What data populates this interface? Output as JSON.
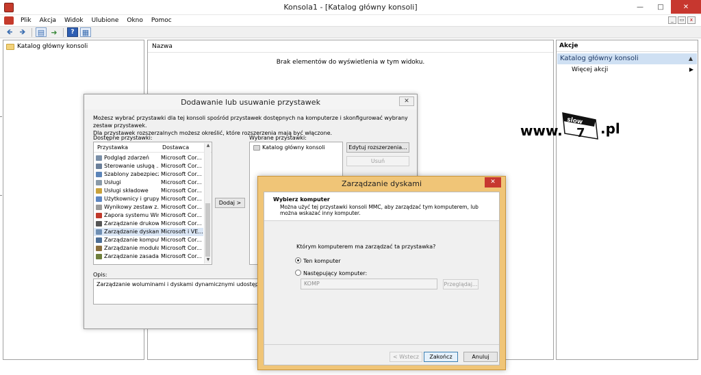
{
  "window": {
    "title": "Konsola1 - [Katalog główny konsoli]"
  },
  "menu": {
    "items": [
      "Plik",
      "Akcja",
      "Widok",
      "Ulubione",
      "Okno",
      "Pomoc"
    ]
  },
  "toolbar": {
    "buttons": [
      "back-arrow-icon",
      "forward-arrow-icon",
      "show-hide-tree-icon",
      "export-list-icon",
      "help-icon",
      "show-hide-action-pane-icon"
    ]
  },
  "tree": {
    "root": "Katalog główny konsoli"
  },
  "center": {
    "column": "Nazwa",
    "empty": "Brak elementów do wyświetlenia w tym widoku."
  },
  "actions": {
    "header": "Akcje",
    "selected": "Katalog główny konsoli",
    "more": "Więcej akcji"
  },
  "logo": {
    "prefix": "www.",
    "box_top": "slow",
    "box_num": "7",
    "suffix": ".pl"
  },
  "snapin_dialog": {
    "title": "Dodawanie lub usuwanie przystawek",
    "intro_line1": "Możesz wybrać przystawki dla tej konsoli spośród przystawek dostępnych na komputerze i skonfigurować wybrany zestaw przystawek.",
    "intro_line2": "Dla przystawek rozszerzalnych możesz określić, które rozszerzenia mają być włączone.",
    "available_label": "Dostępne przystawki:",
    "col_snapin": "Przystawka",
    "col_vendor": "Dostawca",
    "available": [
      {
        "name": "Podgląd zdarzeń",
        "vendor": "Microsoft Cor...",
        "color": "#7a8fa8"
      },
      {
        "name": "Sterowanie usługą ...",
        "vendor": "Microsoft Cor...",
        "color": "#6a7f9a"
      },
      {
        "name": "Szablony zabezpieczeń",
        "vendor": "Microsoft Cor...",
        "color": "#5b84b8"
      },
      {
        "name": "Usługi",
        "vendor": "Microsoft Cor...",
        "color": "#8a9aa8"
      },
      {
        "name": "Usługi składowe",
        "vendor": "Microsoft Cor...",
        "color": "#c9a23c"
      },
      {
        "name": "Użytkownicy i grupy...",
        "vendor": "Microsoft Cor...",
        "color": "#5d86c2"
      },
      {
        "name": "Wynikowy zestaw z...",
        "vendor": "Microsoft Cor...",
        "color": "#9a9a9a"
      },
      {
        "name": "Zapora systemu Win...",
        "vendor": "Microsoft Cor...",
        "color": "#c0392b"
      },
      {
        "name": "Zarządzanie drukow...",
        "vendor": "Microsoft Cor...",
        "color": "#555555"
      },
      {
        "name": "Zarządzanie dyskami",
        "vendor": "Microsoft i VE...",
        "color": "#6f8fb3"
      },
      {
        "name": "Zarządzanie komput...",
        "vendor": "Microsoft Cor...",
        "color": "#4c6e96"
      },
      {
        "name": "Zarządzanie moduła...",
        "vendor": "Microsoft Cor...",
        "color": "#8a6e3c"
      },
      {
        "name": "Zarządzanie zasada...",
        "vendor": "Microsoft Cor...",
        "color": "#6e7f3c"
      }
    ],
    "selected_index": 9,
    "add_button": "Dodaj >",
    "selected_label": "Wybrane przystawki:",
    "selected_item": "Katalog główny konsoli",
    "edit_ext_button": "Edytuj rozszerzenia...",
    "remove_button": "Usuń",
    "desc_label": "Opis:",
    "desc_text": "Zarządzanie woluminami i dyskami dynamicznymi udostępnione firmie M"
  },
  "disk_dialog": {
    "title": "Zarządzanie dyskami",
    "header_title": "Wybierz komputer",
    "header_text": "Można użyć tej przystawki konsoli MMC, aby zarządzać tym komputerem, lub można wskazać inny komputer.",
    "question": "Którym komputerem ma zarządzać ta przystawka?",
    "option_local": "Ten komputer",
    "option_other": "Następujący komputer:",
    "computer_value": "KOMP",
    "browse_button": "Przeglądaj...",
    "back_button": "< Wstecz",
    "finish_button": "Zakończ",
    "cancel_button": "Anuluj"
  }
}
